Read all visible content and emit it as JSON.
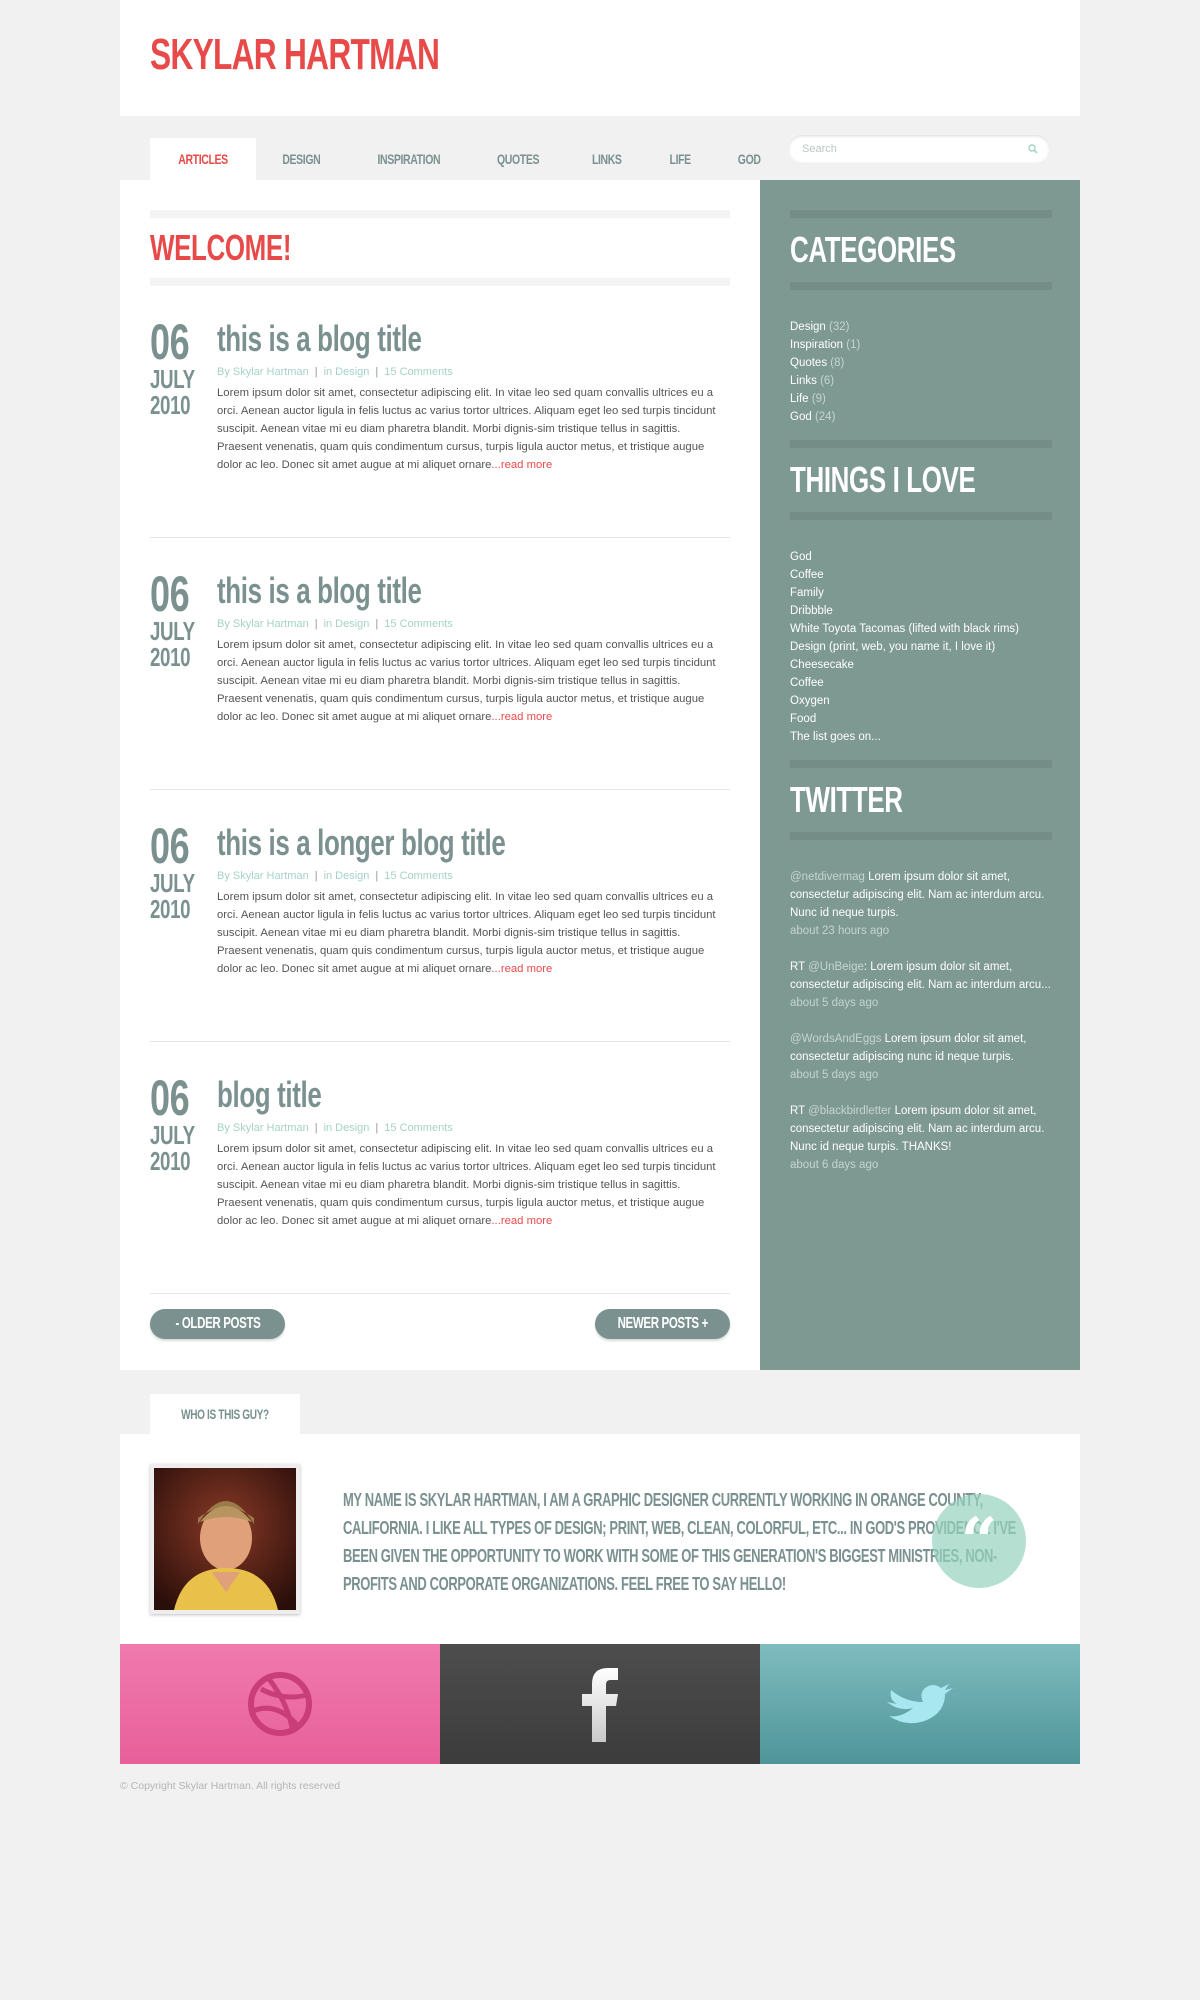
{
  "site": {
    "title": "SKYLAR HARTMAN"
  },
  "nav": {
    "items": [
      "ARTICLES",
      "DESIGN",
      "INSPIRATION",
      "QUOTES",
      "LINKS",
      "LIFE",
      "GOD"
    ],
    "active": "ARTICLES"
  },
  "search": {
    "placeholder": "Search"
  },
  "welcome": "WELCOME!",
  "posts": [
    {
      "day": "06",
      "month": "JULY",
      "year": "2010",
      "title": "this is a blog title",
      "author": "By Skylar Hartman",
      "category": "in Design",
      "comments": "15 Comments",
      "excerpt": "Lorem ipsum dolor sit amet, consectetur adipiscing elit. In vitae leo sed quam convallis ultrices eu a orci. Aenean auctor ligula in felis luctus ac varius tortor ultrices. Aliquam eget leo sed turpis tincidunt suscipit. Aenean vitae mi eu diam pharetra blandit. Morbi dignis-sim tristique tellus in sagittis. Praesent venenatis, quam quis condimentum cursus, turpis ligula auctor metus, et tristique augue dolor ac leo. Donec sit amet augue at mi aliquet ornare",
      "read_more": "...read more"
    },
    {
      "day": "06",
      "month": "JULY",
      "year": "2010",
      "title": "this is a blog title",
      "author": "By Skylar Hartman",
      "category": "in Design",
      "comments": "15 Comments",
      "excerpt": "Lorem ipsum dolor sit amet, consectetur adipiscing elit. In vitae leo sed quam convallis ultrices eu a orci. Aenean auctor ligula in felis luctus ac varius tortor ultrices. Aliquam eget leo sed turpis tincidunt suscipit. Aenean vitae mi eu diam pharetra blandit. Morbi dignis-sim tristique tellus in sagittis. Praesent venenatis, quam quis condimentum cursus, turpis ligula auctor metus, et tristique augue dolor ac leo. Donec sit amet augue at mi aliquet ornare",
      "read_more": "...read more"
    },
    {
      "day": "06",
      "month": "JULY",
      "year": "2010",
      "title": "this is a longer blog title",
      "author": "By Skylar Hartman",
      "category": "in Design",
      "comments": "15 Comments",
      "excerpt": "Lorem ipsum dolor sit amet, consectetur adipiscing elit. In vitae leo sed quam convallis ultrices eu a orci. Aenean auctor ligula in felis luctus ac varius tortor ultrices. Aliquam eget leo sed turpis tincidunt suscipit. Aenean vitae mi eu diam pharetra blandit. Morbi dignis-sim tristique tellus in sagittis. Praesent venenatis, quam quis condimentum cursus, turpis ligula auctor metus, et tristique augue dolor ac leo. Donec sit amet augue at mi aliquet ornare",
      "read_more": "...read more"
    },
    {
      "day": "06",
      "month": "JULY",
      "year": "2010",
      "title": "blog title",
      "author": "By Skylar Hartman",
      "category": "in Design",
      "comments": "15 Comments",
      "excerpt": "Lorem ipsum dolor sit amet, consectetur adipiscing elit. In vitae leo sed quam convallis ultrices eu a orci. Aenean auctor ligula in felis luctus ac varius tortor ultrices. Aliquam eget leo sed turpis tincidunt suscipit. Aenean vitae mi eu diam pharetra blandit. Morbi dignis-sim tristique tellus in sagittis. Praesent venenatis, quam quis condimentum cursus, turpis ligula auctor metus, et tristique augue dolor ac leo. Donec sit amet augue at mi aliquet ornare",
      "read_more": "...read more"
    }
  ],
  "pager": {
    "older": "- OLDER POSTS",
    "newer": "NEWER POSTS +"
  },
  "sidebar": {
    "categories": {
      "title": "CATEGORIES",
      "items": [
        {
          "name": "Design",
          "count": "(32)"
        },
        {
          "name": "Inspiration",
          "count": "(1)"
        },
        {
          "name": "Quotes",
          "count": "(8)"
        },
        {
          "name": "Links",
          "count": "(6)"
        },
        {
          "name": "Life",
          "count": "(9)"
        },
        {
          "name": "God",
          "count": "(24)"
        }
      ]
    },
    "things": {
      "title": "THINGS I LOVE",
      "items": [
        "God",
        "Coffee",
        "Family",
        "Dribbble",
        "White Toyota Tacomas (lifted with black rims)",
        "Design (print, web, you name it, I love it)",
        "Cheesecake",
        "Coffee",
        "Oxygen",
        "Food",
        "The list goes on..."
      ]
    },
    "twitter": {
      "title": "TWITTER",
      "tweets": [
        {
          "prefix": "",
          "handle": "@netdivermag",
          "text": " Lorem ipsum dolor sit amet, consectetur adipiscing elit. Nam ac interdum arcu. Nunc id neque turpis.",
          "time": "about 23 hours ago"
        },
        {
          "prefix": "RT ",
          "handle": "@UnBeige",
          "text": ": Lorem ipsum dolor sit amet, consectetur adipiscing elit. Nam ac interdum arcu...",
          "time": "about 5 days ago"
        },
        {
          "prefix": "",
          "handle": "@WordsAndEggs",
          "text": " Lorem ipsum dolor sit amet, consectetur adipiscing nunc id neque turpis.",
          "time": "about 5 days ago"
        },
        {
          "prefix": "RT ",
          "handle": "@blackbirdletter",
          "text": " Lorem ipsum dolor sit amet, consectetur adipiscing elit. Nam ac interdum arcu. Nunc id neque turpis. THANKS!",
          "time": "about 6 days ago"
        }
      ]
    }
  },
  "about": {
    "tab": "WHO IS THIS GUY?",
    "text": "MY NAME IS SKYLAR HARTMAN, I AM A GRAPHIC DESIGNER CURRENTLY WORKING IN ORANGE COUNTY, CALIFORNIA. I LIKE ALL TYPES OF DESIGN; PRINT, WEB, CLEAN, COLORFUL, ETC... IN GOD'S PROVIDENCE I'VE BEEN GIVEN THE OPPORTUNITY TO WORK WITH SOME OF THIS GENERATION'S BIGGEST MINISTRIES, NON-PROFITS AND CORPORATE ORGANIZATIONS. FEEL FREE TO SAY HELLO!",
    "quote_mark": "“"
  },
  "social": {
    "icons": [
      "dribbble-icon",
      "facebook-icon",
      "twitter-bird-icon"
    ]
  },
  "footer": {
    "copyright": "© Copyright Skylar Hartman. All rights reserved"
  },
  "colors": {
    "accent": "#e84a4a",
    "slate": "#7a9190",
    "sidebar": "#7e9892",
    "mint": "#a6d3c7"
  }
}
